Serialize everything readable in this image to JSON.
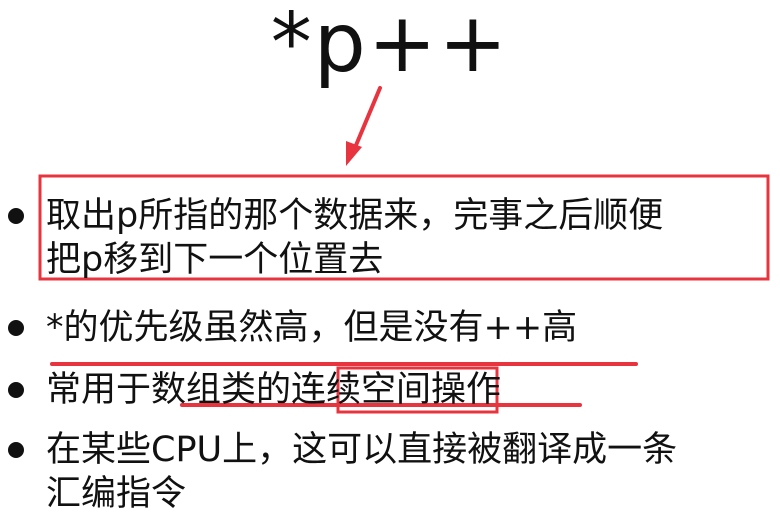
{
  "slide": {
    "title": "*p++",
    "bullets": [
      {
        "lines": [
          "取出p所指的那个数据来，完事之后顺便",
          "把p移到下一个位置去"
        ]
      },
      {
        "lines": [
          "*的优先级虽然高，但是没有++高"
        ]
      },
      {
        "lines": [
          "常用于数组类的连续空间操作"
        ]
      },
      {
        "lines": [
          "在某些CPU上，这可以直接被翻译成一条",
          "汇编指令"
        ]
      }
    ]
  },
  "annotations": {
    "color": "#e8343f"
  }
}
